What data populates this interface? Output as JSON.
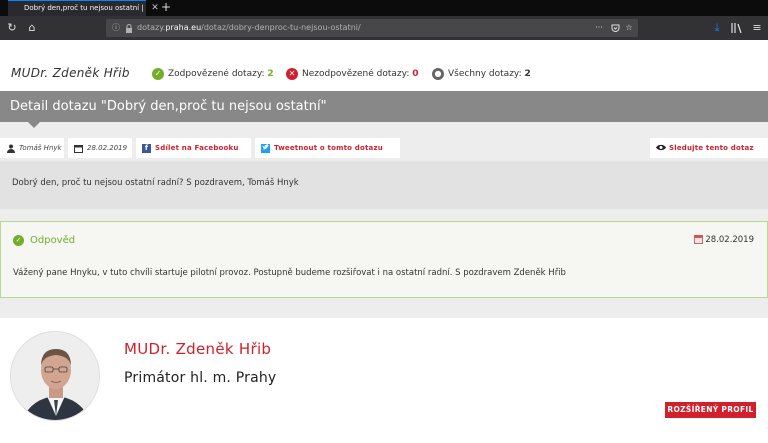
{
  "browser": {
    "tab_title": "Dobrý den,proč tu nejsou ostatní | D",
    "tab_close": "✕",
    "new_tab": "+",
    "url_prefix": "dotazy.",
    "url_host": "praha.eu",
    "url_path": "/dotaz/dobry-denproc-tu-nejsou-ostatni/",
    "url_more": "···"
  },
  "header": {
    "doctor_name": "MUDr. Zdeněk Hřib",
    "stats": [
      {
        "label": "Zodpovězené dotazy: ",
        "count": "2",
        "color": "#72ad2b"
      },
      {
        "label": "Nezodpovězené dotazy: ",
        "count": "0",
        "color": "#d11f2b"
      },
      {
        "label": "Všechny dotazy: ",
        "count": "2",
        "color": "#333333"
      }
    ]
  },
  "detail": {
    "title": "Detail dotazu \"Dobrý den,proč tu nejsou ostatní\""
  },
  "meta": {
    "author": "Tomáš Hnyk",
    "date": "28.02.2019",
    "share_facebook": "Sdílet na Facebooku",
    "tweet": "Tweetnout o tomto dotazu",
    "follow": "Sledujte tento dotaz"
  },
  "question": {
    "text": "Dobrý den, proč tu nejsou ostatní radní? S pozdravem, Tomáš Hnyk"
  },
  "answer": {
    "label": "Odpověd",
    "date": "28.02.2019",
    "text": "Vážený pane Hnyku, v tuto chvíli startuje pilotní provoz. Postupně budeme rozšiřovat i na ostatní radní. S pozdravem Zdeněk Hřib"
  },
  "profile": {
    "name": "MUDr. Zdeněk Hřib",
    "role": "Primátor hl. m. Prahy",
    "button": "ROZŠÍŘENÝ PROFIL"
  },
  "colors": {
    "accent_red": "#d11f2b",
    "accent_green": "#72ad2b",
    "title_gray": "#888888"
  }
}
